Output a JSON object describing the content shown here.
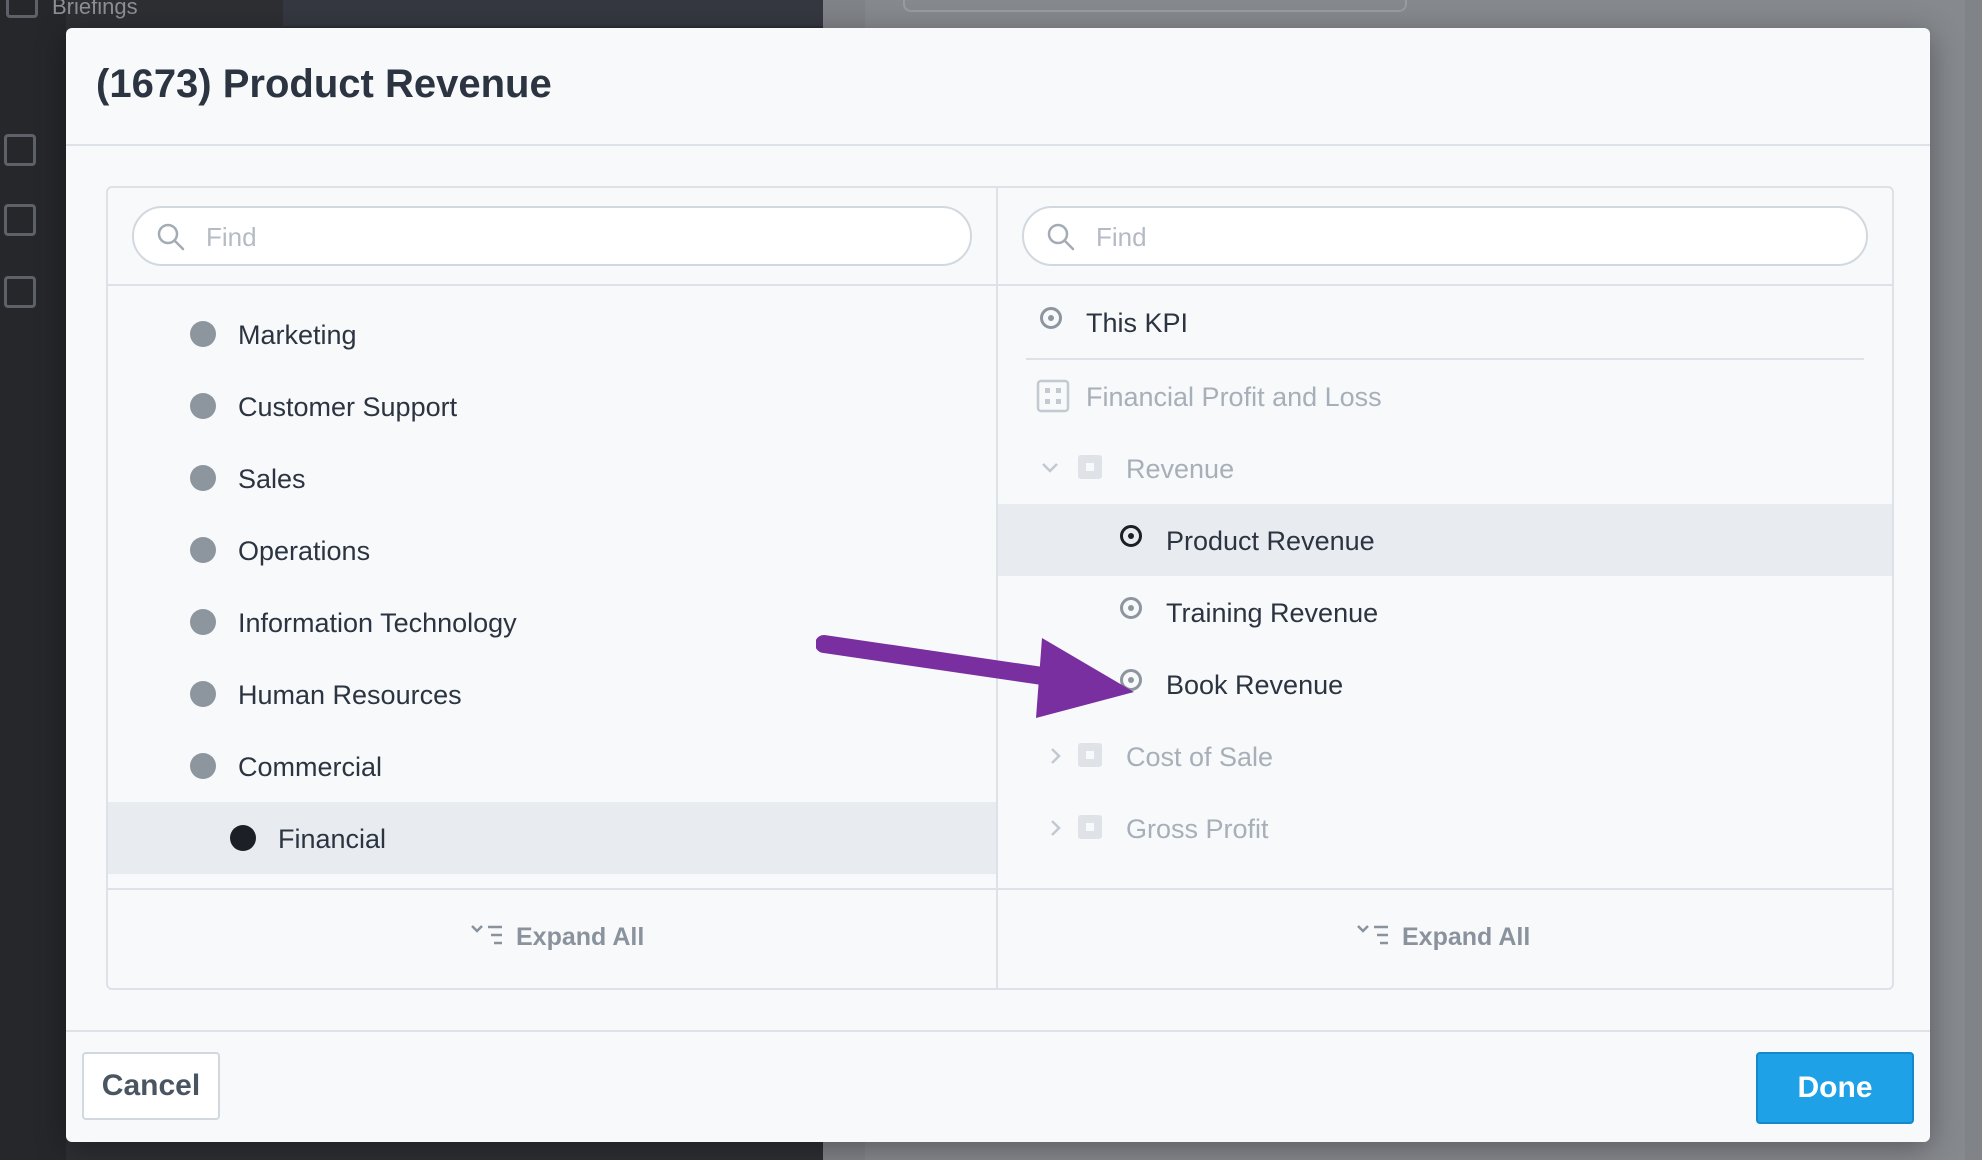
{
  "background": {
    "nav_items": [
      "Briefings"
    ]
  },
  "dialog": {
    "title": "(1673) Product Revenue"
  },
  "left_panel": {
    "search_placeholder": "Find",
    "items": [
      {
        "label": "Marketing",
        "selected": false
      },
      {
        "label": "Customer Support",
        "selected": false
      },
      {
        "label": "Sales",
        "selected": false
      },
      {
        "label": "Operations",
        "selected": false
      },
      {
        "label": "Information Technology",
        "selected": false
      },
      {
        "label": "Human Resources",
        "selected": false
      },
      {
        "label": "Commercial",
        "selected": false
      },
      {
        "label": "Financial",
        "selected": true
      }
    ],
    "expand_all_label": "Expand All"
  },
  "right_panel": {
    "search_placeholder": "Find",
    "this_kpi_label": "This KPI",
    "scorecard_label": "Financial Profit and Loss",
    "tree": [
      {
        "label": "Revenue",
        "expanded": true,
        "children": [
          {
            "label": "Product Revenue",
            "selected": true
          },
          {
            "label": "Training Revenue",
            "selected": false
          },
          {
            "label": "Book Revenue",
            "selected": false
          }
        ]
      },
      {
        "label": "Cost of Sale",
        "expanded": false
      },
      {
        "label": "Gross Profit",
        "expanded": false
      }
    ],
    "expand_all_label": "Expand All"
  },
  "footer": {
    "cancel_label": "Cancel",
    "done_label": "Done"
  },
  "colors": {
    "accent": "#1ea1e6",
    "annotation_arrow": "#7a2fa0",
    "selected_row": "#e8ecf0"
  }
}
